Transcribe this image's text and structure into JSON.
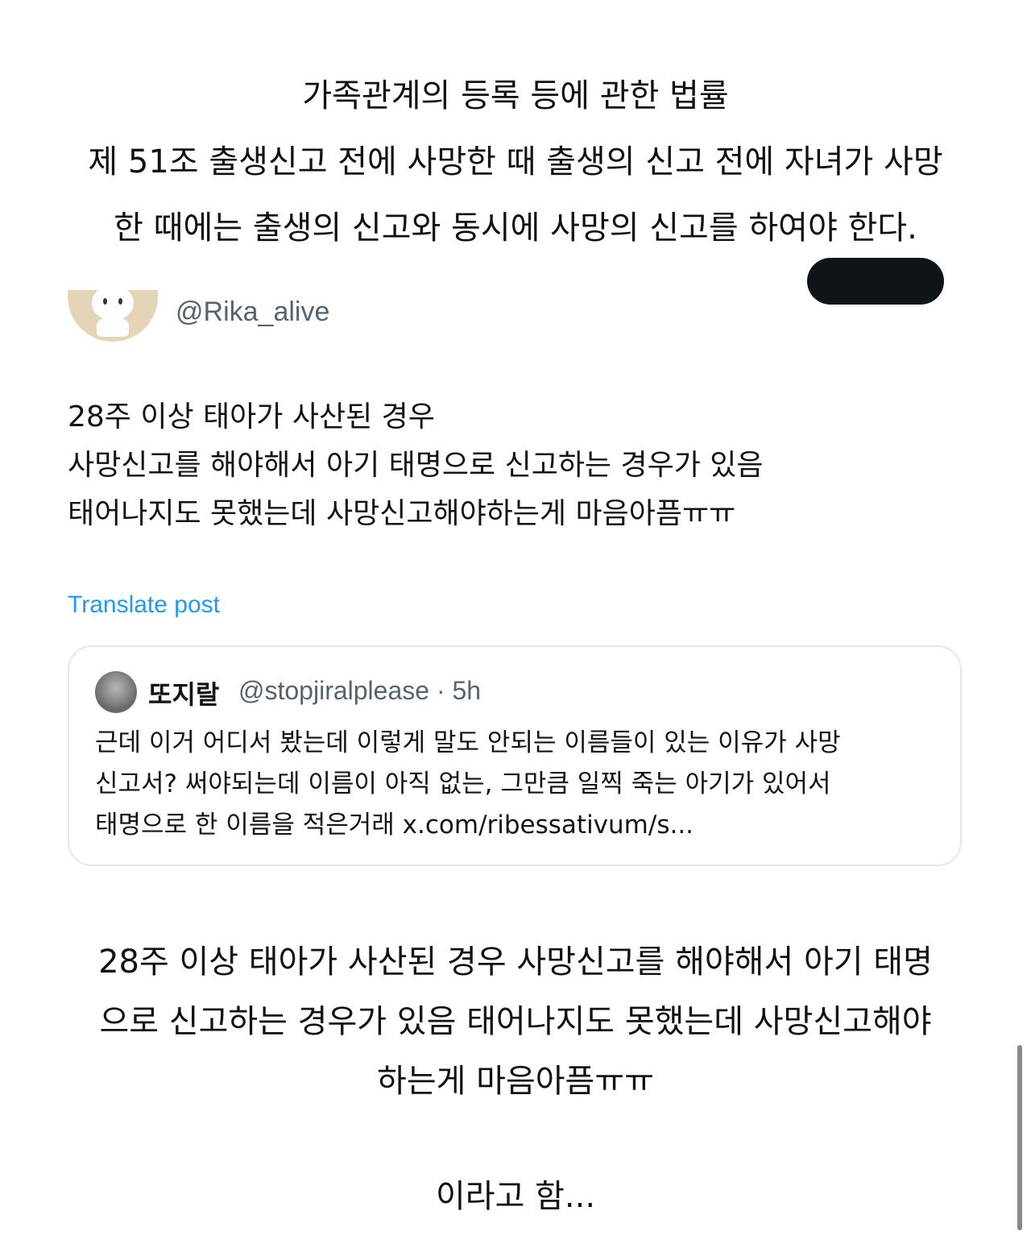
{
  "law_text": {
    "lines": [
      "가족관계의 등록 등에 관한 법률",
      "제 51조 출생신고 전에 사망한 때 출생의 신고 전에 자녀가 사망",
      "한 때에는 출생의 신고와 동시에 사망의 신고를 하여야 한다."
    ]
  },
  "tweet": {
    "handle": "@Rika_alive",
    "avatar_icon": "cat-avatar-icon",
    "body_lines": [
      "28주 이상 태아가 사산된 경우",
      "사망신고를 해야해서 아기 태명으로 신고하는 경우가 있음",
      "태어나지도 못했는데 사망신고해야하는게 마음아픔ㅠㅠ"
    ],
    "translate_label": "Translate post",
    "link_color": "#1d9bf0"
  },
  "quote": {
    "name": "또지랄",
    "handle_time": "@stopjiralplease · 5h",
    "text_lines": [
      "근데 이거 어디서 봤는데 이렇게 말도 안되는 이름들이 있는 이유가 사망",
      "신고서? 써야되는데 이름이 아직 없는, 그만큼 일찍 죽는 아기가 있어서",
      "태명으로 한 이름을 적은거래 x.com/ribessativum/s..."
    ]
  },
  "summary": {
    "lines": [
      "28주 이상 태아가 사산된 경우 사망신고를 해야해서 아기 태명",
      "으로 신고하는 경우가 있음 태어나지도 못했는데 사망신고해야",
      "하는게 마음아픔ㅠㅠ"
    ],
    "closing": "이라고 함..."
  }
}
